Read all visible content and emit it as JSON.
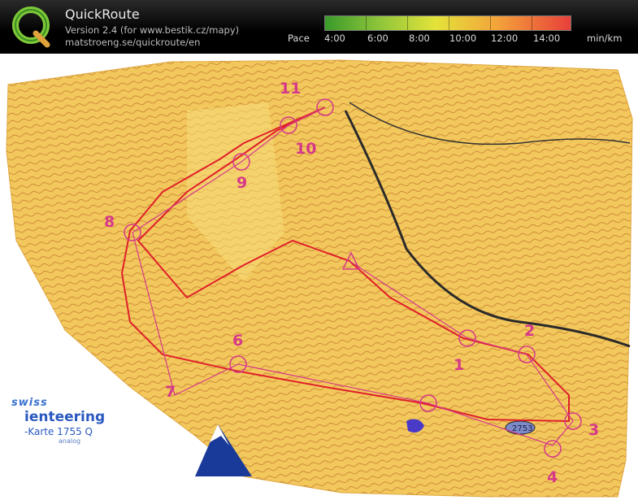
{
  "header": {
    "app_title": "QuickRoute",
    "version_line": "Version 2.4  (for www.bestik.cz/mapy)",
    "url_line": "matstroeng.se/quickroute/en",
    "pace_label": "Pace",
    "pace_ticks": [
      "4:00",
      "6:00",
      "8:00",
      "10:00",
      "12:00",
      "14:00"
    ],
    "pace_unit": "min/km",
    "pace_colors": [
      "#3a9a2a",
      "#e3e33a",
      "#e8403a"
    ]
  },
  "map": {
    "legend": {
      "brand_top": "swiss",
      "brand_main": "ienteering",
      "map_name": "-Karte 1755 Q",
      "small_text": "analog"
    },
    "lake_label": "2753",
    "controls": [
      "1",
      "2",
      "3",
      "4",
      "6",
      "7",
      "8",
      "9",
      "10",
      "11"
    ],
    "colors": {
      "terrain": "#f2c75c",
      "route": "#e0202a",
      "course": "#d6388a",
      "water": "#2a3aa8"
    }
  }
}
